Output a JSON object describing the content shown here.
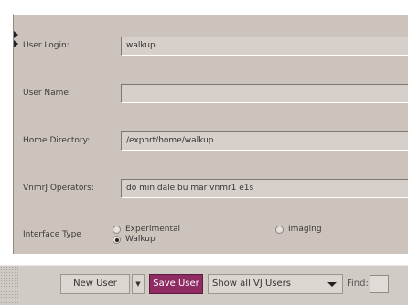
{
  "form": {
    "user_login": {
      "label": "User Login:",
      "value": "walkup"
    },
    "user_name": {
      "label": "User Name:",
      "value": ""
    },
    "home_directory": {
      "label": "Home Directory:",
      "value": "/export/home/walkup"
    },
    "vnmrj_operators": {
      "label": "VnmrJ Operators:",
      "value": "do min  dale bu mar vnmr1 e1s"
    },
    "interface_type": {
      "label": "Interface Type",
      "options": [
        {
          "label": "Experimental",
          "selected": false
        },
        {
          "label": "Walkup",
          "selected": true
        },
        {
          "label": "Imaging",
          "selected": false
        }
      ]
    }
  },
  "toolbar": {
    "new_user_label": "New User",
    "save_user_label": "Save User",
    "user_filter_value": "Show all VJ Users",
    "find_label": "Find:",
    "find_value": ""
  },
  "icons": {
    "dropdown_arrow": "chevron-down-icon",
    "select_arrow": "triangle-down-icon",
    "panel_grip": "collapse-arrow-icon"
  },
  "colors": {
    "panel_bg": "#cdc3bd",
    "save_button_bg": "#8e2b62",
    "save_button_text": "#ffffff"
  }
}
